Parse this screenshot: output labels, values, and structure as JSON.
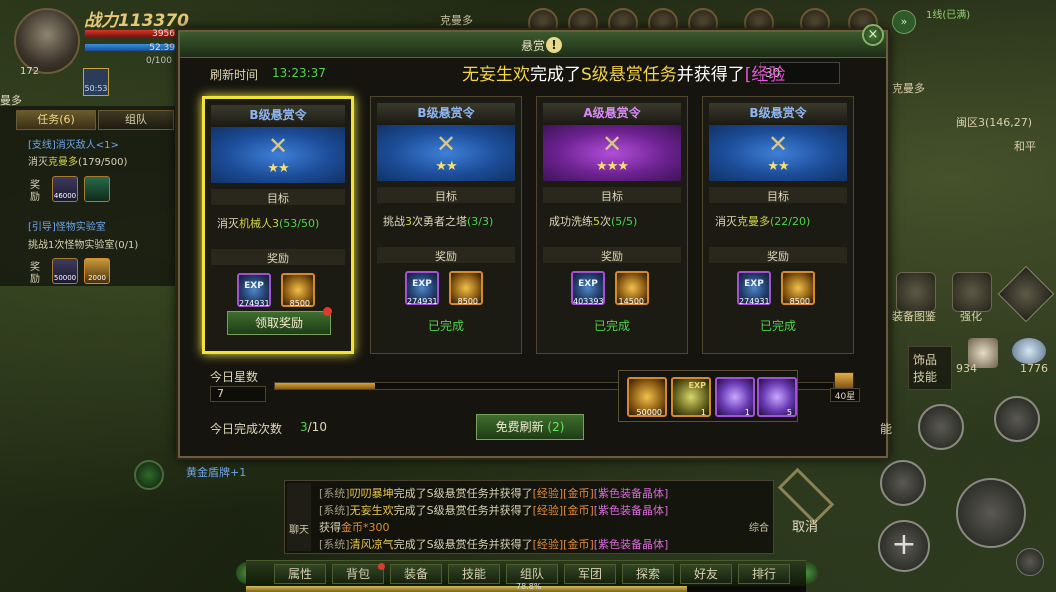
{
  "hud": {
    "power_label": "战力",
    "power_value": "113370",
    "level": "172",
    "hp": "3956",
    "mp": "52.39",
    "exp_small": "0/100",
    "buff_timer": "50:53",
    "map_left": "曼多",
    "top_map": "克曼多",
    "right_map": "克曼多",
    "zone": "闽区3(146,27)",
    "peace": "和平",
    "line": "1线(已满)"
  },
  "task_panel": {
    "tab_task": "任务(6)",
    "tab_team": "组队",
    "task1_title": "[支线]消灭敌人<1>",
    "task1_text_pre": "消灭",
    "task1_target": "克曼多",
    "task1_progress": "(179/500)",
    "reward_label": "奖励",
    "task1_reward1": "46000",
    "task2_title": "[引导]怪物实验室",
    "task2_text": "挑战1次怪物实验室(0/1)",
    "task2_reward1": "50000",
    "task2_reward2": "2000"
  },
  "dialog": {
    "title": "悬赏",
    "info_icon": "!",
    "close_icon": "×",
    "refresh_label": "刷新时间",
    "refresh_time": "13:23:37",
    "ticker_name": "无妄生欢",
    "ticker_mid1": "完成了",
    "ticker_task": "S级悬赏任务",
    "ticker_mid2": "并获得了",
    "ticker_item": "[经验",
    "ticker_box": "30",
    "cards": [
      {
        "title": "B级悬赏令",
        "title_color": "#8fb6f2",
        "banner": "blue",
        "stars": "★★",
        "target_label": "目标",
        "obj_pre": "消灭",
        "obj_hl": "机械人3",
        "obj_progress": "(53/50)",
        "reward_label": "奖励",
        "exp": "274931",
        "gold": "8500",
        "status": "领取奖励"
      },
      {
        "title": "B级悬赏令",
        "title_color": "#8fb6f2",
        "banner": "blue",
        "stars": "★★",
        "target_label": "目标",
        "obj_pre": "挑战",
        "obj_hl": "3",
        "obj_post": "次勇者之塔",
        "obj_progress": "(3/3)",
        "reward_label": "奖励",
        "exp": "274931",
        "gold": "8500",
        "status": "已完成"
      },
      {
        "title": "A级悬赏令",
        "title_color": "#d88af5",
        "banner": "purple",
        "stars": "★★★",
        "target_label": "目标",
        "obj_pre": "成功洗练",
        "obj_hl": "5",
        "obj_post": "次",
        "obj_progress": "(5/5)",
        "reward_label": "奖励",
        "exp": "403393",
        "gold": "14500",
        "status": "已完成"
      },
      {
        "title": "B级悬赏令",
        "title_color": "#8fb6f2",
        "banner": "blue",
        "stars": "★★",
        "target_label": "目标",
        "obj_pre": "消灭",
        "obj_hl": "克曼多",
        "obj_progress": "(22/20)",
        "reward_label": "奖励",
        "exp": "274931",
        "gold": "8500",
        "status": "已完成"
      }
    ],
    "exp_badge": "EXP",
    "stars_label": "今日星数",
    "stars_value": "7",
    "star_progress": 0.18,
    "chest_label": "40星",
    "count_label": "今日完成次数",
    "count_done": "3",
    "count_total": "/10",
    "free_refresh": "免费刷新",
    "free_count": "(2)",
    "chest_rewards": [
      {
        "icon": "gold-coins-icon",
        "count": "50000"
      },
      {
        "icon": "exp-scroll-icon",
        "count": "1",
        "badge": "EXP"
      },
      {
        "icon": "purple-crystal-icon",
        "count": "1"
      },
      {
        "icon": "purple-crystal-icon",
        "count": "5"
      }
    ]
  },
  "right_hud": {
    "equip_map": "装备图鉴",
    "strengthen": "强化",
    "jewelry": "饰品技能",
    "item1_count": "934",
    "item2_count": "1776",
    "skill_tail": "能",
    "cancel": "取消",
    "composite": "综合"
  },
  "chat": {
    "side_label": "聊天",
    "lines": [
      {
        "sys": "[系统]",
        "name": "叨叨暴坤",
        "mid": "完成了S级悬赏任务并获得了",
        "a": "[经验]",
        "b": "[金币]",
        "c": "[紫色装备晶体]"
      },
      {
        "sys": "[系统]",
        "name": "无妄生欢",
        "mid": "完成了S级悬赏任务并获得了",
        "a": "[经验]",
        "b": "[金币]",
        "c": "[紫色装备晶体]"
      },
      {
        "plain": "获得",
        "gold": "金币*300"
      },
      {
        "sys": "[系统]",
        "name": "清风凉气",
        "mid": "完成了S级悬赏任务并获得了",
        "a": "[经验]",
        "b": "[金币]",
        "c": "[紫色装备晶体]"
      }
    ],
    "left_hint": "黄金盾牌+1"
  },
  "menu": [
    "属性",
    "背包",
    "装备",
    "技能",
    "组队",
    "军团",
    "探索",
    "好友",
    "排行"
  ],
  "exp_percent": "78.8%"
}
